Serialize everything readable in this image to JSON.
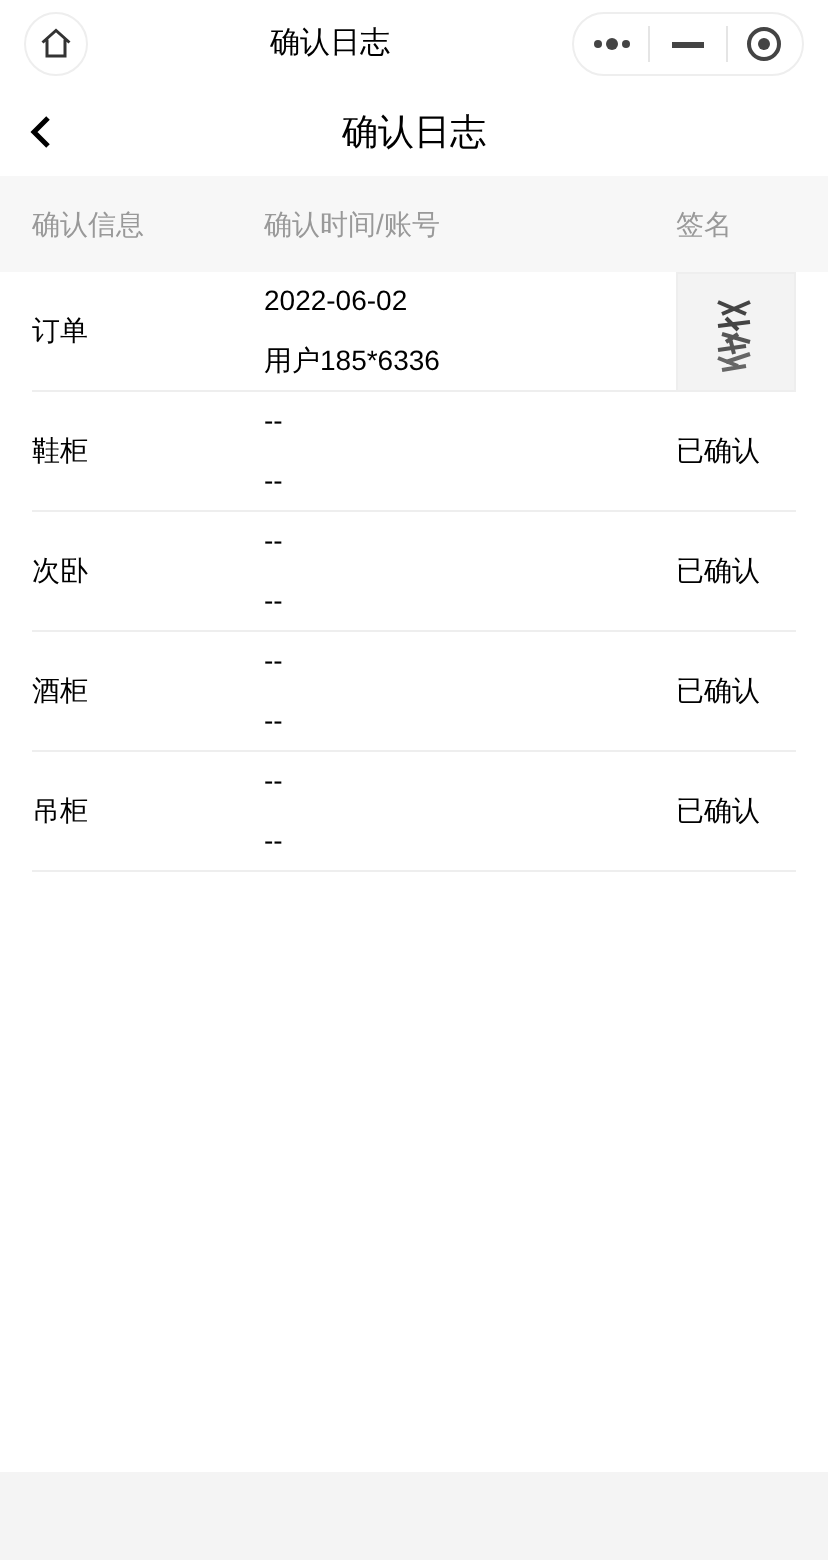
{
  "capsule_bar": {
    "title": "确认日志"
  },
  "nav_bar": {
    "title": "确认日志"
  },
  "table": {
    "columns": [
      "确认信息",
      "确认时间/账号",
      "签名"
    ],
    "rows": [
      {
        "item": "订单",
        "time": "2022-06-02",
        "account": "用户185*6336"
      },
      {
        "item": "鞋柜",
        "time": "--",
        "account": "--",
        "signature": {
          "kind": "status",
          "text": "已确认"
        }
      },
      {
        "item": "次卧",
        "time": "--",
        "account": "--",
        "signature": {
          "kind": "status",
          "text": "已确认"
        }
      },
      {
        "item": "酒柜",
        "time": "--",
        "account": "--",
        "signature": {
          "kind": "status",
          "text": "已确认"
        }
      },
      {
        "item": "吊柜",
        "time": "--",
        "account": "--",
        "signature": {
          "kind": "status",
          "text": "已确认"
        }
      }
    ]
  }
}
